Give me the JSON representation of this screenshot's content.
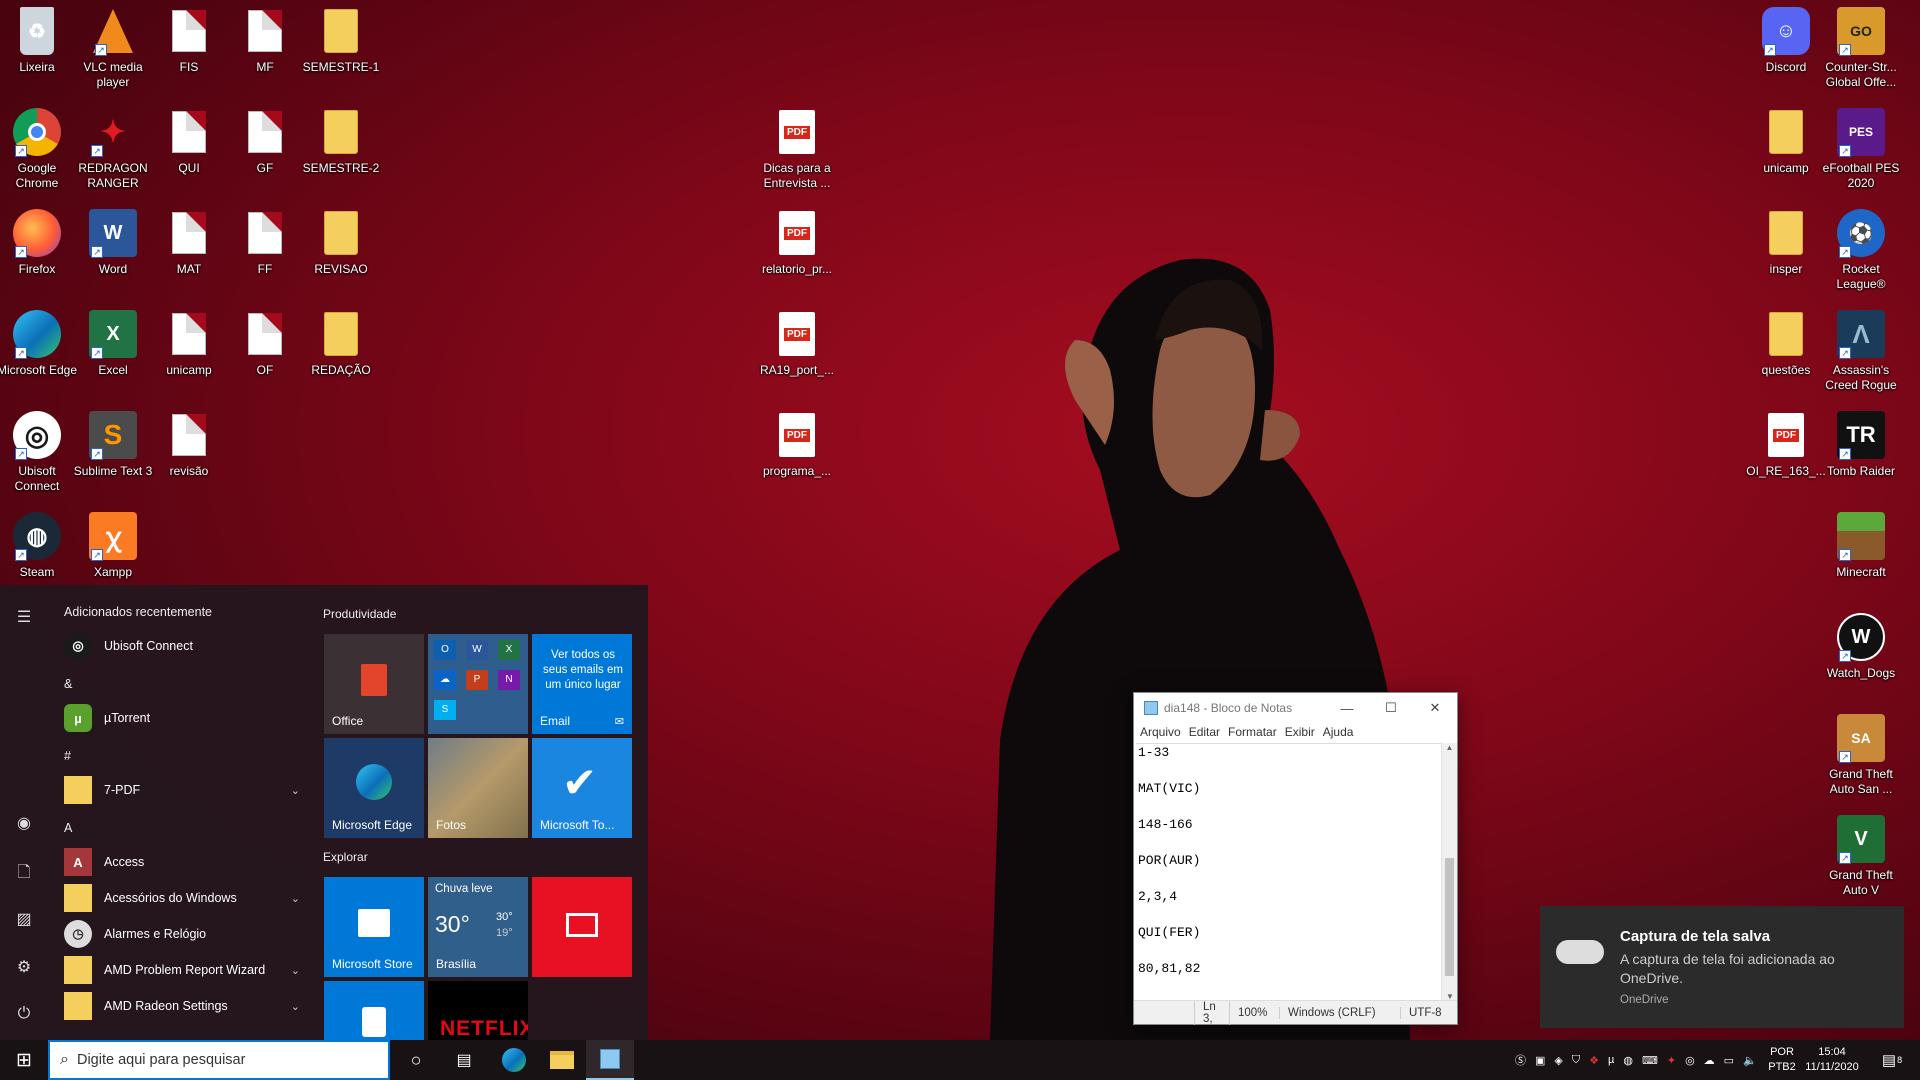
{
  "desktop": {
    "icons_left": [
      {
        "label": "Lixeira",
        "icon": "recycle-bin-icon"
      },
      {
        "label": "VLC media player",
        "icon": "vlc-icon"
      },
      {
        "label": "FIS",
        "icon": "file-icon"
      },
      {
        "label": "MF",
        "icon": "file-icon"
      },
      {
        "label": "SEMESTRE-1",
        "icon": "folder-icon"
      },
      {
        "label": "Google Chrome",
        "icon": "chrome-icon"
      },
      {
        "label": "REDRAGON RANGER",
        "icon": "redragon-icon"
      },
      {
        "label": "QUI",
        "icon": "file-icon"
      },
      {
        "label": "GF",
        "icon": "file-icon"
      },
      {
        "label": "SEMESTRE-2",
        "icon": "folder-icon"
      },
      {
        "label": "Firefox",
        "icon": "firefox-icon"
      },
      {
        "label": "Word",
        "icon": "word-icon"
      },
      {
        "label": "MAT",
        "icon": "file-icon"
      },
      {
        "label": "FF",
        "icon": "file-icon"
      },
      {
        "label": "REVISAO",
        "icon": "folder-icon"
      },
      {
        "label": "Microsoft Edge",
        "icon": "edge-icon"
      },
      {
        "label": "Excel",
        "icon": "excel-icon"
      },
      {
        "label": "unicamp",
        "icon": "file-icon"
      },
      {
        "label": "OF",
        "icon": "file-icon"
      },
      {
        "label": "REDAÇÃO",
        "icon": "folder-icon"
      },
      {
        "label": "Ubisoft Connect",
        "icon": "ubisoft-icon"
      },
      {
        "label": "Sublime Text 3",
        "icon": "sublime-icon"
      },
      {
        "label": "revisão",
        "icon": "file-icon"
      },
      {
        "label": "Steam",
        "icon": "steam-icon"
      },
      {
        "label": "Xampp",
        "icon": "xampp-icon"
      }
    ],
    "icons_middle": [
      {
        "label": "Dicas para a Entrevista ...",
        "icon": "pdf-icon"
      },
      {
        "label": "relatorio_pr...",
        "icon": "pdf-icon"
      },
      {
        "label": "RA19_port_...",
        "icon": "pdf-icon"
      },
      {
        "label": "programa_...",
        "icon": "pdf-icon"
      }
    ],
    "icons_right": [
      {
        "label": "Discord",
        "icon": "discord-icon"
      },
      {
        "label": "Counter-Str... Global Offe...",
        "icon": "csgo-icon"
      },
      {
        "label": "unicamp",
        "icon": "folder-icon"
      },
      {
        "label": "eFootball PES 2020",
        "icon": "pes-icon"
      },
      {
        "label": "insper",
        "icon": "folder-icon"
      },
      {
        "label": "Rocket League®",
        "icon": "rocket-league-icon"
      },
      {
        "label": "questões",
        "icon": "folder-icon"
      },
      {
        "label": "Assassin's Creed Rogue",
        "icon": "assassins-creed-icon"
      },
      {
        "label": "OI_RE_163_...",
        "icon": "pdf-icon"
      },
      {
        "label": "Tomb Raider",
        "icon": "tomb-raider-icon"
      },
      {
        "label": "Minecraft",
        "icon": "minecraft-icon"
      },
      {
        "label": "Watch_Dogs",
        "icon": "watch-dogs-icon"
      },
      {
        "label": "Grand Theft Auto San ...",
        "icon": "gta-sa-icon"
      },
      {
        "label": "Grand Theft Auto V",
        "icon": "gta-v-icon"
      }
    ],
    "pdf_badge": "PDF"
  },
  "start_menu": {
    "recent_header": "Adicionados recentemente",
    "apps": [
      {
        "label": "Ubisoft Connect",
        "icon": "ubisoft-icon",
        "expand": false
      },
      {
        "label": "µTorrent",
        "icon": "utorrent-icon",
        "expand": false
      },
      {
        "label": "7-PDF",
        "icon": "folder-icon",
        "expand": true
      },
      {
        "label": "Access",
        "icon": "access-icon",
        "expand": false
      },
      {
        "label": "Acessórios do Windows",
        "icon": "folder-icon",
        "expand": true
      },
      {
        "label": "Alarmes e Relógio",
        "icon": "clock-icon",
        "expand": false
      },
      {
        "label": "AMD Problem Report Wizard",
        "icon": "folder-icon",
        "expand": true
      },
      {
        "label": "AMD Radeon Settings",
        "icon": "folder-icon",
        "expand": true
      }
    ],
    "letters": [
      "&",
      "#",
      "A"
    ],
    "tiles_sections": [
      "Produtividade",
      "Explorar"
    ],
    "tiles": {
      "office": "Office",
      "email_text": "Ver todos os seus emails em um único lugar",
      "email": "Email",
      "edge": "Microsoft Edge",
      "photos": "Fotos",
      "todo": "Microsoft To...",
      "store": "Microsoft Store",
      "weather_cond": "Chuva leve",
      "weather_temp": "30°",
      "weather_hi": "30°",
      "weather_lo": "19°",
      "weather_city": "Brasília",
      "netflix": "NETFLIX"
    }
  },
  "notepad": {
    "title": "dia148 - Bloco de Notas",
    "menu": [
      "Arquivo",
      "Editar",
      "Formatar",
      "Exibir",
      "Ajuda"
    ],
    "content": "1-33\n\nMAT(VIC)\n\n148-166\n\nPOR(AUR)\n\n2,3,4\n\nQUI(FER)\n\n80,81,82",
    "status": {
      "position": "Ln 3,",
      "zoom": "100%",
      "eol": "Windows (CRLF)",
      "encoding": "UTF-8"
    }
  },
  "toast": {
    "title": "Captura de tela salva",
    "body": "A captura de tela foi adicionada ao OneDrive.",
    "source": "OneDrive"
  },
  "taskbar": {
    "search_placeholder": "Digite aqui para pesquisar",
    "lang_1": "POR",
    "lang_2": "PTB2",
    "time": "15:04",
    "date": "11/11/2020",
    "notif_count": "8"
  }
}
